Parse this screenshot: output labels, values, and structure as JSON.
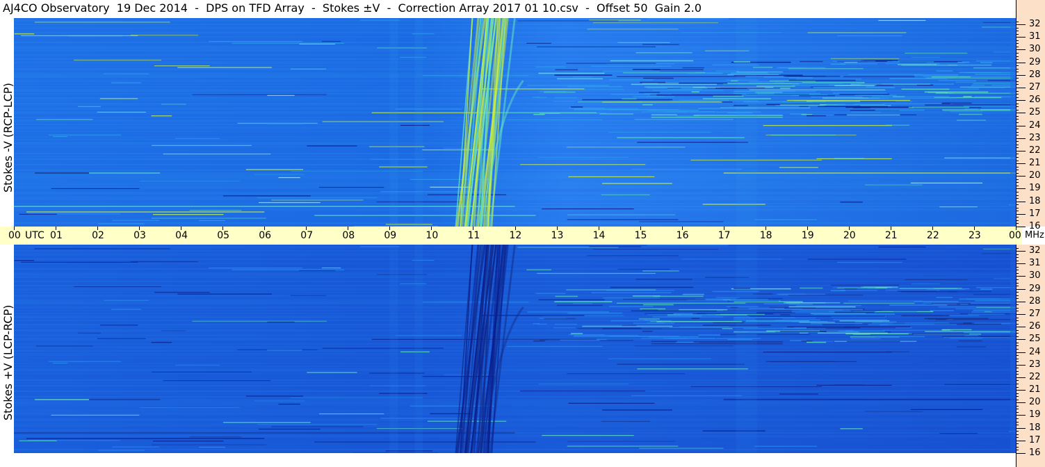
{
  "title": "AJ4CO Observatory  19 Dec 2014  -  DPS on TFD Array  -  Stokes ±V  -  Correction Array 2017 01 10.csv  -  Offset 50  Gain 2.0",
  "chart_data": [
    {
      "type": "heatmap",
      "panel": "top",
      "ylabel": "Stokes -V (RCP-LCP)",
      "x_ticks": [
        "00",
        "01",
        "02",
        "03",
        "04",
        "05",
        "06",
        "07",
        "08",
        "09",
        "10",
        "11",
        "12",
        "13",
        "14",
        "15",
        "16",
        "17",
        "18",
        "19",
        "20",
        "21",
        "22",
        "23",
        "00"
      ],
      "x_unit": "UTC",
      "y_ticks": [
        32,
        31,
        30,
        29,
        28,
        27,
        26,
        25,
        24,
        23,
        22,
        21,
        20,
        19,
        18,
        17,
        16
      ],
      "y_unit": "MHz",
      "x_range": [
        0,
        24
      ],
      "y_range": [
        16,
        32.5
      ],
      "colormap": [
        "#0a1e8c",
        "#1f6fe6",
        "#2f9ff0",
        "#5fe0c0",
        "#c8f040"
      ]
    },
    {
      "type": "heatmap",
      "panel": "bottom",
      "ylabel": "Stokes +V (LCP-RCP)",
      "x_ticks": [
        "00",
        "01",
        "02",
        "03",
        "04",
        "05",
        "06",
        "07",
        "08",
        "09",
        "10",
        "11",
        "12",
        "13",
        "14",
        "15",
        "16",
        "17",
        "18",
        "19",
        "20",
        "21",
        "22",
        "23",
        "00"
      ],
      "x_unit": "UTC",
      "y_ticks": [
        32,
        31,
        30,
        29,
        28,
        27,
        26,
        25,
        24,
        23,
        22,
        21,
        20,
        19,
        18,
        17,
        16
      ],
      "y_unit": "MHz",
      "x_range": [
        0,
        24
      ],
      "y_range": [
        16,
        32.5
      ],
      "colormap": [
        "#0a1e8c",
        "#1a5fdc",
        "#2f9ff0",
        "#5fe0c0",
        "#c8f040"
      ]
    }
  ],
  "axis": {
    "utc_label": "UTC",
    "mhz_label": "MHz"
  }
}
